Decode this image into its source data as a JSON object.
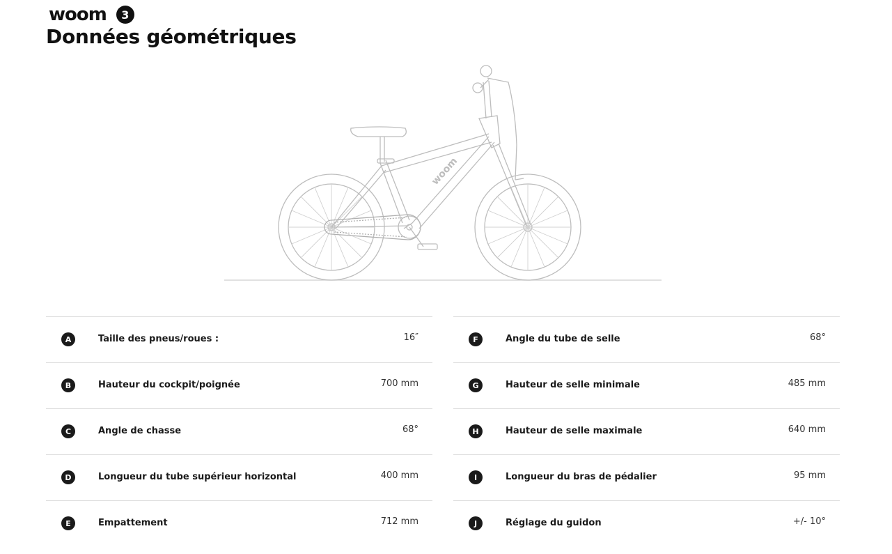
{
  "brand": {
    "logo": "woom",
    "model_number": "3"
  },
  "page": {
    "title": "Données géométriques"
  },
  "illustration": {
    "icon": "bicycle-side-view",
    "stroke_color": "#bdbdbd",
    "frame_logo": "woom"
  },
  "specs_left": [
    {
      "letter": "A",
      "label": "Taille des pneus/roues :",
      "value": "16″"
    },
    {
      "letter": "B",
      "label": "Hauteur du cockpit/poignée",
      "value": "700 mm"
    },
    {
      "letter": "C",
      "label": "Angle de chasse",
      "value": "68°"
    },
    {
      "letter": "D",
      "label": "Longueur du tube supérieur horizontal",
      "value": "400 mm"
    },
    {
      "letter": "E",
      "label": "Empattement",
      "value": "712 mm"
    }
  ],
  "specs_right": [
    {
      "letter": "F",
      "label": "Angle du tube de selle",
      "value": "68°"
    },
    {
      "letter": "G",
      "label": "Hauteur de selle minimale",
      "value": "485 mm"
    },
    {
      "letter": "H",
      "label": "Hauteur de selle maximale",
      "value": "640 mm"
    },
    {
      "letter": "I",
      "label": "Longueur du bras de pédalier",
      "value": "95 mm"
    },
    {
      "letter": "J",
      "label": "Réglage du guidon",
      "value": "+/- 10°"
    }
  ],
  "colors": {
    "text": "#1a1a1a",
    "divider": "#dcdcdc",
    "badge": "#1a1a1a"
  }
}
